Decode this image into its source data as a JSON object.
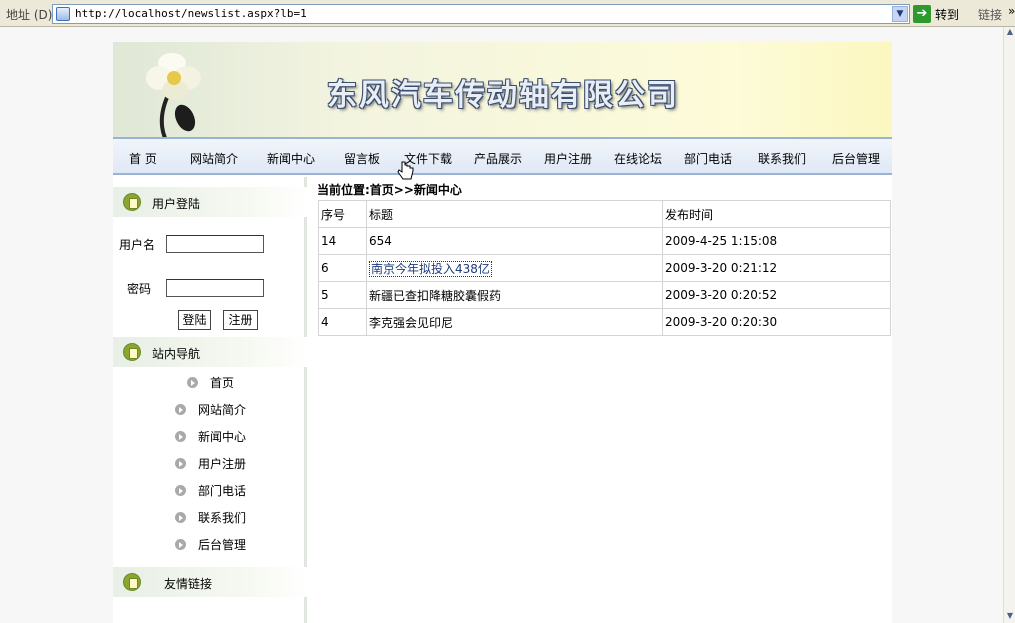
{
  "browser": {
    "address_label": "地址 (D)",
    "url": "http://localhost/newslist.aspx?lb=1",
    "go_label": "转到",
    "links_label": "链接"
  },
  "banner": {
    "title": "东风汽车传动轴有限公司"
  },
  "nav": [
    "首 页",
    "网站简介",
    "新闻中心",
    "留言板",
    "文件下载",
    "产品展示",
    "用户注册",
    "在线论坛",
    "部门电话",
    "联系我们",
    "后台管理"
  ],
  "login": {
    "title": "用户登陆",
    "username_label": "用户名",
    "password_label": "密码",
    "login_button": "登陆",
    "register_button": "注册"
  },
  "site_nav": {
    "title": "站内导航",
    "items": [
      "首页",
      "网站简介",
      "新闻中心",
      "用户注册",
      "部门电话",
      "联系我们",
      "后台管理"
    ]
  },
  "friend_links": {
    "title": "友情链接"
  },
  "breadcrumb": "当前位置:首页>>新闻中心",
  "news_table": {
    "headers": [
      "序号",
      "标题",
      "发布时间"
    ],
    "rows": [
      [
        "14",
        "654",
        "2009-4-25 1:15:08"
      ],
      [
        "6",
        "南京今年拟投入438亿",
        "2009-3-20 0:21:12"
      ],
      [
        "5",
        "新疆已查扣降糖胶囊假药",
        "2009-3-20 0:20:52"
      ],
      [
        "4",
        "李克强会见印尼",
        "2009-3-20 0:20:30"
      ]
    ]
  }
}
